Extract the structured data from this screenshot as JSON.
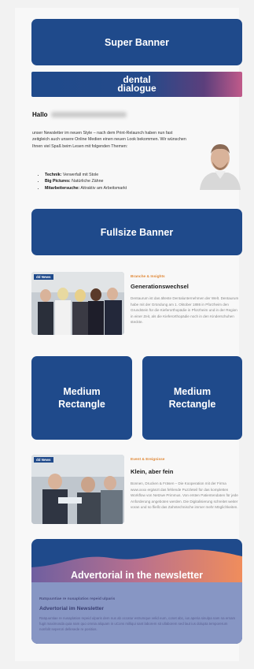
{
  "ads": {
    "super_banner": "Super Banner",
    "fullsize_banner": "Fullsize Banner",
    "medium_rectangle_left": [
      "Medium",
      "Rectangle"
    ],
    "medium_rectangle_right": [
      "Medium",
      "Rectangle"
    ]
  },
  "logo": {
    "line1": "dental",
    "line2": "dialogue"
  },
  "intro": {
    "greeting": "Hallo",
    "text": "unser Newsletter im neuen Style – nach dem Print-Relaunch haben nun fast zeitgleich auch unsere Online Medien einen neuen Look bekommen. Wir wünschen Ihnen viel Spaß beim Lesen mit folgenden Themen:",
    "bullets": [
      {
        "label": "Technik:",
        "text": "Verwerfall mit Stole"
      },
      {
        "label": "Big Pictures:",
        "text": "Natürliche Zähne"
      },
      {
        "label": "Mitarbeitersuche:",
        "text": "Attraktiv am Arbeitsmarkt"
      }
    ]
  },
  "articles": [
    {
      "tag": "dd News",
      "category": "Branche & Insights",
      "title": "Generationswechsel",
      "text": "Dentaurum ist das älteste Dentalunternehmen der Welt. Dentaurum habe mit der Gründung am 1. Oktober 1886 in Pforzheim den Grundstein für die Kieferorthopädie in Pforzheim und in der Region in einer Zeit, als die Kieferorthopädie noch in den Kinderschuhen steckte."
    },
    {
      "tag": "dd News",
      "category": "Event & Ereignisse",
      "title": "Klein, aber fein",
      "text": "Bonnen, Drucken & Fräsen – Die Kooperation mit der Firma www.xxxx ergänzt das fehlende Puzzleteil für das kompletten Workflow von Netzwe Primmus. Von ersten Patientendaten für jede Anforderung angeboten werden. Die Digitalisierung schreitet weiter voran und so fließt das Zahntechnische immer mehr Möglichkeiten."
    }
  ],
  "advertorial": {
    "title": "Advertorial in the newsletter",
    "kicker": "Ratquuntiae re nusaplatios repeid ulparis",
    "headline": "Advertorial im Newsletter",
    "text": "Ratquuntiae re nusaplatios repeid ulparis dem nus ab occatur estrumque velid eum, conet abc, ius aperia sinulpa nam na ernam fugit maximosda quia nam quo omnia aliquam in uCons milliqui sant laborem sit ullaborem sed laut ius dolupta temporerum nonfolit seperori dellesede re positios."
  },
  "colors": {
    "ad_blue": "#1f4a8b",
    "accent_orange": "#e08a3a",
    "advertorial_body": "#8796c4"
  }
}
